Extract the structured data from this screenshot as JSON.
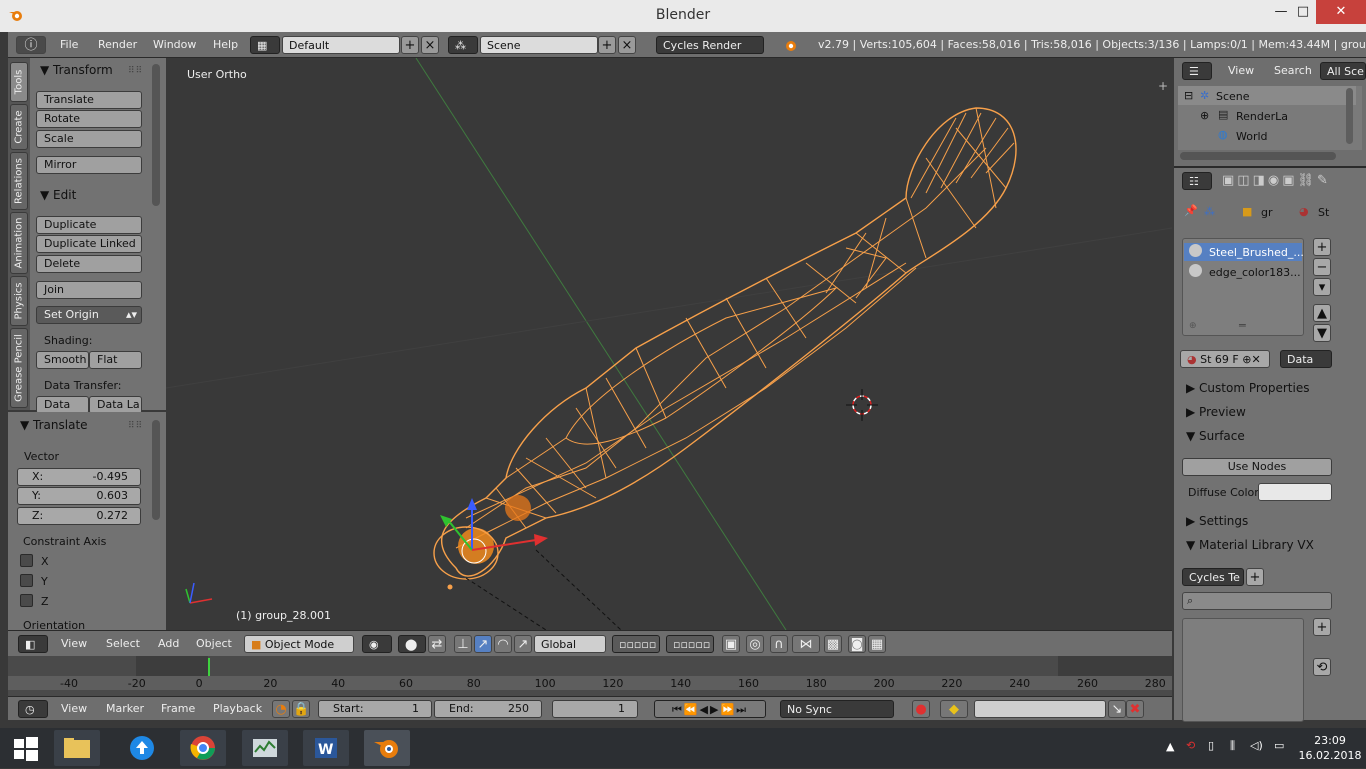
{
  "window": {
    "title": "Blender",
    "close_glyph": "✕",
    "max_glyph": "□",
    "min_glyph": "—"
  },
  "header": {
    "menus": [
      "File",
      "Render",
      "Window",
      "Help"
    ],
    "layout": "Default",
    "scene": "Scene",
    "render_engine": "Cycles Render",
    "status": "v2.79 | Verts:105,604 | Faces:58,016 | Tris:58,016 | Objects:3/136 | Lamps:0/1 | Mem:43.44M | group_28.001"
  },
  "tool_tabs": [
    "Tools",
    "Create",
    "Relations",
    "Animation",
    "Physics",
    "Grease Pencil"
  ],
  "tools": {
    "transform_title": "Transform",
    "translate": "Translate",
    "rotate": "Rotate",
    "scale": "Scale",
    "mirror": "Mirror",
    "edit_title": "Edit",
    "duplicate": "Duplicate",
    "duplicate_linked": "Duplicate Linked",
    "delete": "Delete",
    "join": "Join",
    "set_origin": "Set Origin",
    "shading_label": "Shading:",
    "smooth": "Smooth",
    "flat": "Flat",
    "data_transfer_label": "Data Transfer:",
    "data": "Data",
    "data_layout": "Data La"
  },
  "operator": {
    "title": "Translate",
    "vector_label": "Vector",
    "x_label": "X:",
    "x": "-0.495",
    "y_label": "Y:",
    "y": "0.603",
    "z_label": "Z:",
    "z": "0.272",
    "constraint_label": "Constraint Axis",
    "ax_x": "X",
    "ax_y": "Y",
    "ax_z": "Z",
    "orientation_label": "Orientation"
  },
  "viewport": {
    "view_name": "User Ortho",
    "object_label": "(1) group_28.001"
  },
  "viewport_header": {
    "menus": [
      "View",
      "Select",
      "Add",
      "Object"
    ],
    "mode": "Object Mode",
    "orientation": "Global"
  },
  "timeline": {
    "ticks": [
      "-40",
      "-20",
      "0",
      "20",
      "40",
      "60",
      "80",
      "100",
      "120",
      "140",
      "160",
      "180",
      "200",
      "220",
      "240",
      "260",
      "280"
    ]
  },
  "timeline_header": {
    "menus": [
      "View",
      "Marker",
      "Frame",
      "Playback"
    ],
    "start_label": "Start:",
    "start": "1",
    "end_label": "End:",
    "end": "250",
    "current": "1",
    "sync": "No Sync"
  },
  "outliner": {
    "view": "View",
    "search": "Search",
    "filter": "All Sce",
    "items": [
      "Scene",
      "RenderLa",
      "World"
    ]
  },
  "properties": {
    "crumb_obj": "gr",
    "crumb_mat": "St",
    "materials": [
      "Steel_Brushed_...",
      "edge_color183..."
    ],
    "mat_short": "St",
    "mat_users": "69",
    "mat_fake": "F",
    "link": "Data",
    "sections": [
      "Custom Properties",
      "Preview",
      "Surface"
    ],
    "use_nodes": "Use Nodes",
    "diffuse_label": "Diffuse Color:",
    "settings": "Settings",
    "material_library": "Material Library VX",
    "cycles_te": "Cycles Te"
  },
  "taskbar": {
    "time": "23:09",
    "date": "16.02.2018"
  },
  "colors": {
    "wire": "#f7a04a",
    "selected": "#f08a1d",
    "bg": "#393939"
  }
}
